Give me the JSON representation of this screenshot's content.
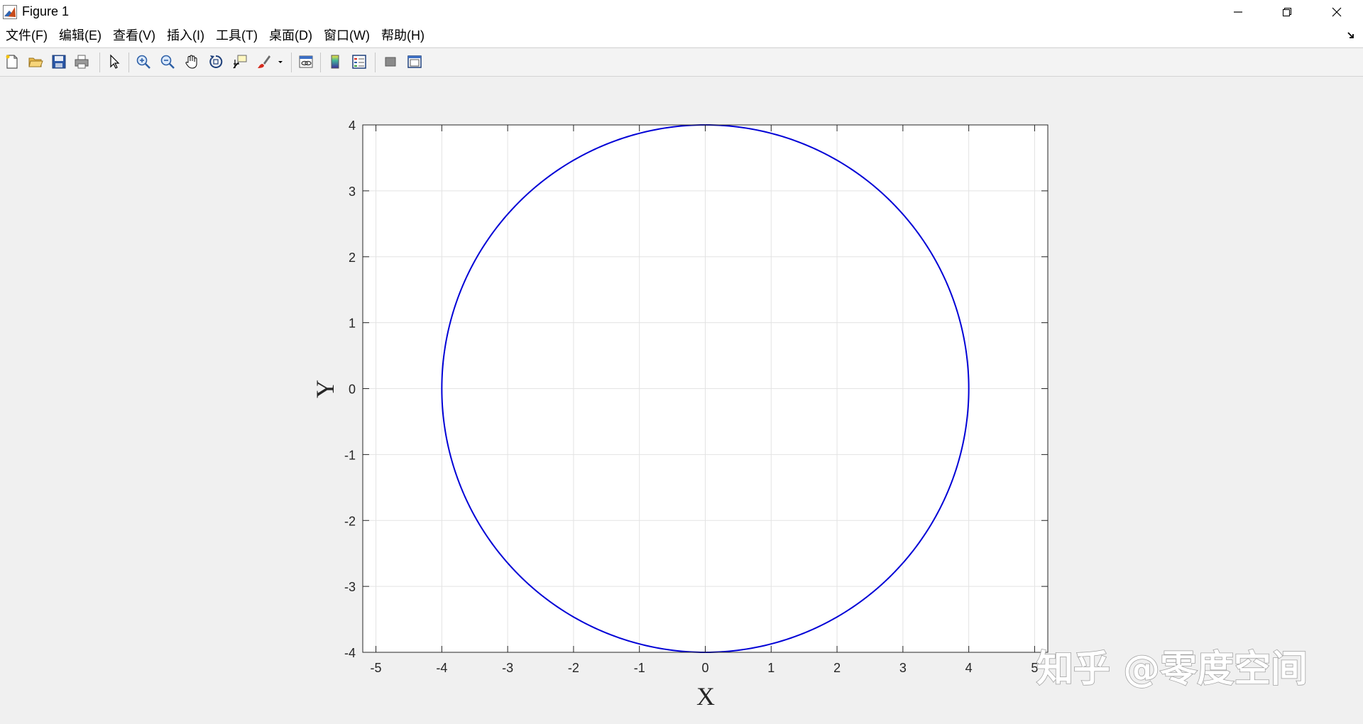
{
  "window": {
    "title": "Figure 1",
    "controls": {
      "minimize": "minimize",
      "restore": "restore",
      "close": "close"
    }
  },
  "menu": {
    "items": [
      {
        "label": "文件(F)"
      },
      {
        "label": "编辑(E)"
      },
      {
        "label": "查看(V)"
      },
      {
        "label": "插入(I)"
      },
      {
        "label": "工具(T)"
      },
      {
        "label": "桌面(D)"
      },
      {
        "label": "窗口(W)"
      },
      {
        "label": "帮助(H)"
      }
    ]
  },
  "toolbar": {
    "buttons": [
      {
        "icon": "new-figure-icon"
      },
      {
        "icon": "open-file-icon"
      },
      {
        "icon": "save-icon"
      },
      {
        "icon": "print-icon"
      },
      {
        "icon": "pointer-icon"
      },
      {
        "icon": "zoom-in-icon"
      },
      {
        "icon": "zoom-out-icon"
      },
      {
        "icon": "pan-hand-icon"
      },
      {
        "icon": "rotate-3d-icon"
      },
      {
        "icon": "data-cursor-icon"
      },
      {
        "icon": "brush-icon"
      },
      {
        "icon": "link-plot-icon"
      },
      {
        "icon": "colorbar-icon"
      },
      {
        "icon": "legend-icon"
      },
      {
        "icon": "hide-plot-tools-icon"
      },
      {
        "icon": "show-plot-tools-icon"
      }
    ]
  },
  "chart_data": {
    "type": "line",
    "title": "",
    "xlabel": "X",
    "ylabel": "Y",
    "xlim": [
      -5.2,
      5.2
    ],
    "ylim": [
      -4,
      4
    ],
    "xticks": [
      -5,
      -4,
      -3,
      -2,
      -1,
      0,
      1,
      2,
      3,
      4,
      5
    ],
    "yticks": [
      -4,
      -3,
      -2,
      -1,
      0,
      1,
      2,
      3,
      4
    ],
    "grid": true,
    "legend": "none",
    "series": [
      {
        "shape": "circle",
        "center": [
          0,
          0
        ],
        "radius": 4,
        "color": "#0000d6",
        "x": [
          4,
          3.464,
          2,
          0,
          -2,
          -3.464,
          -4,
          -3.464,
          -2,
          0,
          2,
          3.464,
          4
        ],
        "y": [
          0,
          2,
          3.464,
          4,
          3.464,
          2,
          0,
          -2,
          -3.464,
          -4,
          -3.464,
          -2,
          0
        ]
      }
    ]
  },
  "watermark": {
    "text": "知乎 @零度空间"
  }
}
